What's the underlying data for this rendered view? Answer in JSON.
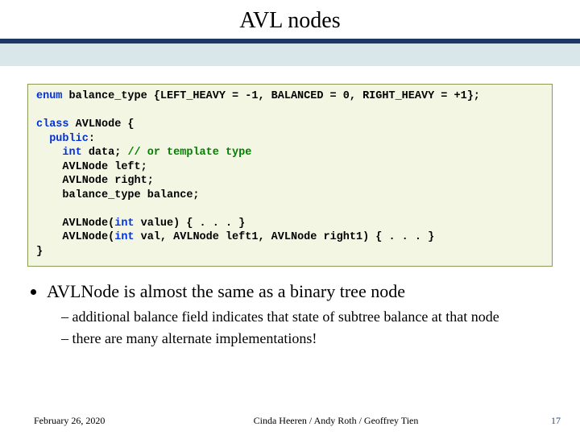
{
  "title": "AVL nodes",
  "code": {
    "kw_enum": "enum",
    "enum_rest": " balance_type {LEFT_HEAVY = -1, BALANCED = 0, RIGHT_HEAVY = +1};",
    "kw_class": "class",
    "class_rest": " AVLNode {",
    "p1": "  ",
    "kw_public": "public",
    "public_rest": ":",
    "p2": "    ",
    "kw_int1": "int",
    "data_rest": " data; ",
    "comment": "// or template type",
    "left_line": "    AVLNode left;",
    "right_line": "    AVLNode right;",
    "balance_line": "    balance_type balance;",
    "ctor1_a": "    AVLNode(",
    "kw_int2": "int",
    "ctor1_b": " value) { . . . }",
    "ctor2_a": "    AVLNode(",
    "kw_int3": "int",
    "ctor2_b": " val, AVLNode left1, AVLNode right1) { . . . }",
    "close": "}"
  },
  "bullet_main": "AVLNode is almost the same as a binary tree node",
  "bullet_sub1": "additional balance field indicates that state of subtree balance at that node",
  "bullet_sub2": "there are many alternate implementations!",
  "footer": {
    "date": "February 26, 2020",
    "credits": "Cinda Heeren / Andy Roth / Geoffrey Tien",
    "page": "17"
  }
}
